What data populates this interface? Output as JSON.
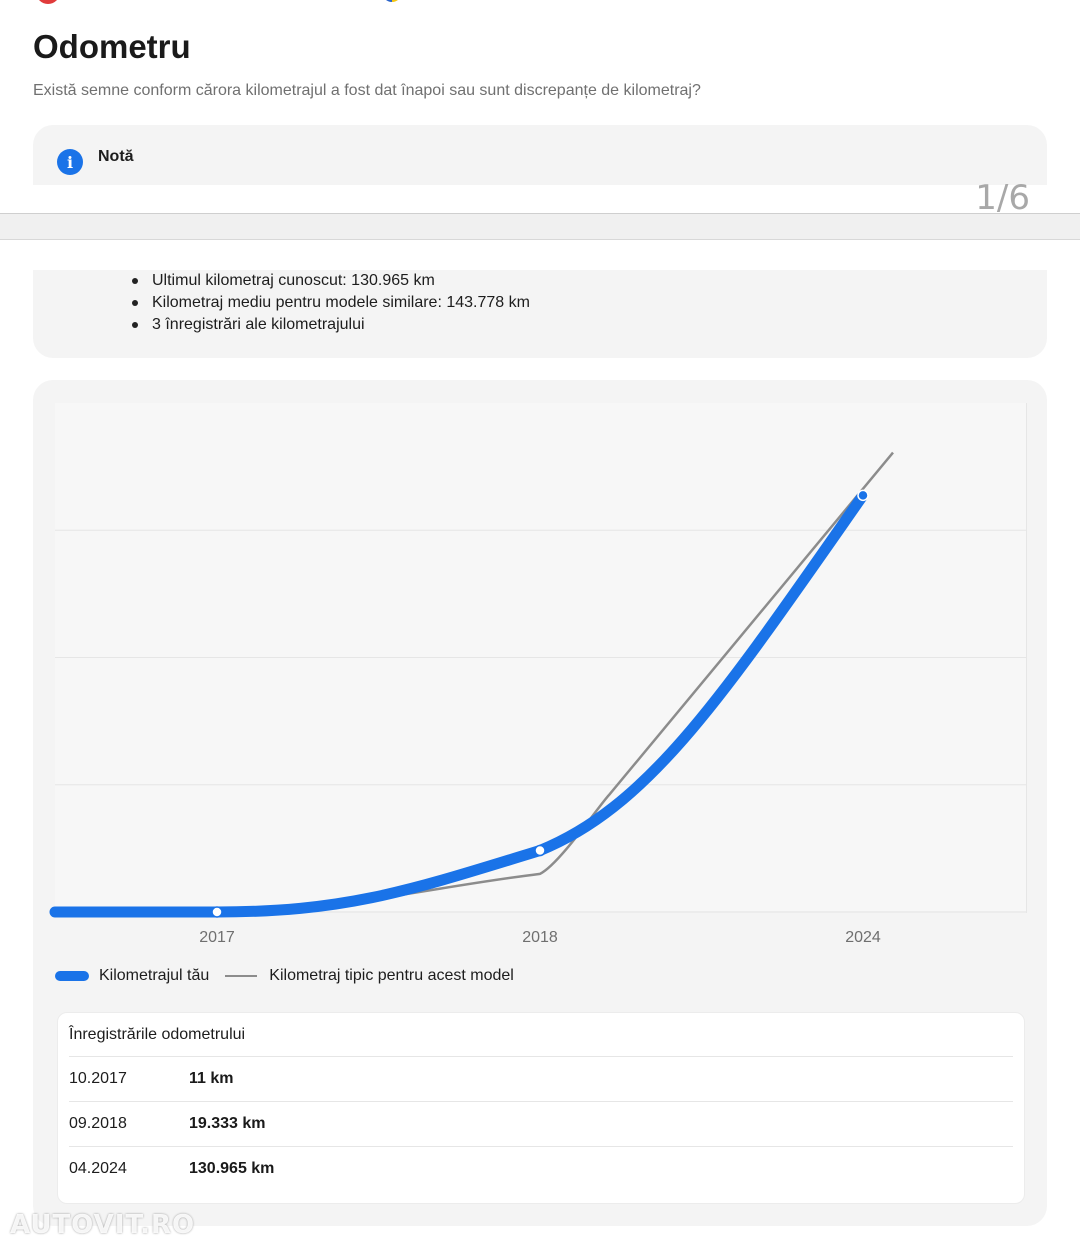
{
  "page": {
    "title": "Odometru",
    "subtitle": "Există semne conform cărora kilometrajul a fost dat înapoi sau sunt discrepanțe de kilometraj?"
  },
  "note": {
    "title": "Notă",
    "icon": "info-icon",
    "bullets": [
      "Ultimul kilometraj cunoscut: 130.965 km",
      "Kilometraj mediu pentru modele similare: 143.778 km",
      "3 înregistrări ale kilometrajului"
    ]
  },
  "pager": "1/6",
  "legend": {
    "your": "Kilometrajul tău",
    "typical": "Kilometraj tipic pentru acest model"
  },
  "records": {
    "title": "Înregistrările odometrului",
    "rows": [
      {
        "date": "10.2017",
        "km": "11 km"
      },
      {
        "date": "09.2018",
        "km": "19.333 km"
      },
      {
        "date": "04.2024",
        "km": "130.965 km"
      }
    ]
  },
  "watermark": "AUTOVIT.RO",
  "colors": {
    "accent": "#1a73e8",
    "typical_line": "#8c8c8c"
  },
  "chart_data": {
    "type": "line",
    "categories": [
      "2017",
      "2018",
      "2024"
    ],
    "series": [
      {
        "name": "Kilometrajul tău",
        "values": [
          11,
          19333,
          130965
        ]
      },
      {
        "name": "Kilometraj tipic pentru acest model",
        "values": [
          0,
          12000,
          143778
        ]
      }
    ],
    "ylim": [
      0,
      160000
    ],
    "grid": true,
    "legend": "bottom-left"
  }
}
